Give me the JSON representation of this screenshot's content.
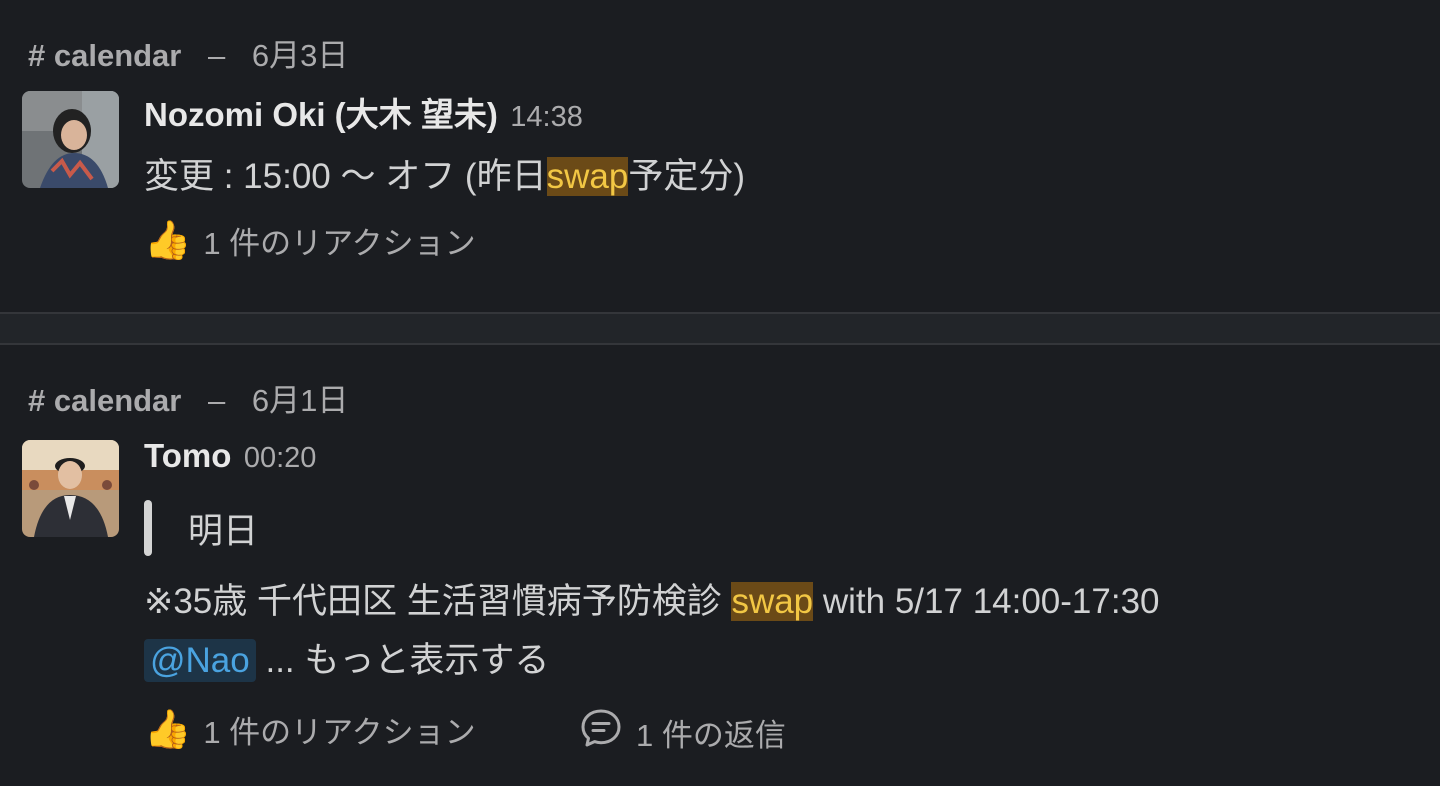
{
  "results": [
    {
      "channel": "# calendar",
      "separator": "–",
      "date": "6月3日",
      "author": "Nozomi Oki (大木 望未)",
      "time": "14:38",
      "message": {
        "before": "変更 : 15:00 〜 オフ (昨日",
        "highlight": "swap",
        "after": "予定分)"
      },
      "reaction": {
        "emoji": "👍",
        "label": "1 件のリアクション"
      }
    },
    {
      "channel": "# calendar",
      "separator": "–",
      "date": "6月1日",
      "author": "Tomo",
      "time": "00:20",
      "quote": "明日",
      "message": {
        "before": "※35歳 千代田区 生活習慣病予防検診 ",
        "highlight": "swap",
        "after": " with 5/17 14:00-17:30"
      },
      "mention": "@Nao",
      "more": "... もっと表示する",
      "reaction": {
        "emoji": "👍",
        "label": "1 件のリアクション"
      },
      "replies": {
        "label": "1 件の返信"
      }
    }
  ],
  "icons": {
    "reply": "reply-bubble-icon",
    "reaction": "thumbs-up-icon"
  },
  "colors": {
    "background": "#1b1d21",
    "highlight_bg": "#6b4a17",
    "highlight_text": "#f2c744",
    "mention_text": "#4aa3e0"
  }
}
